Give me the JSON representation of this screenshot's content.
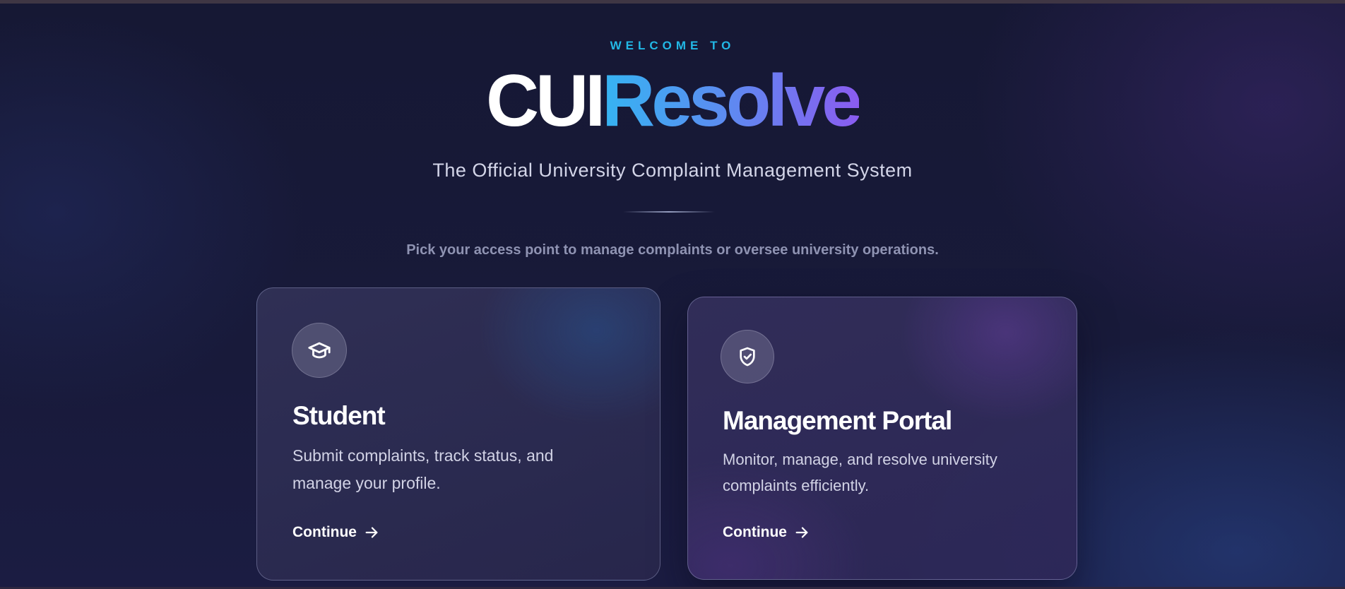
{
  "hero": {
    "welcome": "WELCOME TO",
    "brand_part1": "CUI",
    "brand_part2": "Resolve",
    "subtitle": "The Official University Complaint Management System",
    "hint": "Pick your access point to manage complaints or oversee university operations."
  },
  "cards": [
    {
      "icon": "graduation-cap-icon",
      "title": "Student",
      "description": "Submit complaints, track status, and manage your profile.",
      "cta": "Continue"
    },
    {
      "icon": "shield-check-icon",
      "title": "Management Portal",
      "description": "Monitor, manage, and resolve university complaints efficiently.",
      "cta": "Continue"
    }
  ],
  "colors": {
    "accent_cyan": "#22b8e6",
    "brand_gradient_start": "#35b4f2",
    "brand_gradient_end": "#8a5cf0",
    "background": "#161834"
  }
}
